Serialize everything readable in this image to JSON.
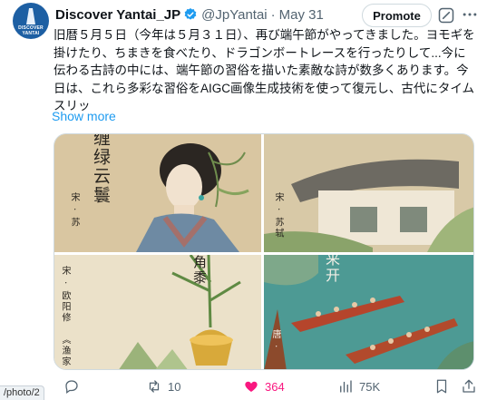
{
  "author": {
    "name": "Discover Yantai_JP",
    "handle": "@JpYantai",
    "separator": "·",
    "date": "May 31",
    "avatar_text": "DISCOVER YANTAI"
  },
  "header_actions": {
    "promote_label": "Promote",
    "grok_icon": "grok-icon",
    "more_icon": "more-icon"
  },
  "tweet": {
    "text": "旧暦５月５日（今年は５月３１日）、再び端午節がやってきました。ヨモギを掛けたり、ちまきを食べたり、ドラゴンボートレースを行ったりして...今に伝わる古詩の中には、端午節の習俗を描いた素敵な詩が数多くあります。今日は、これら多彩な習俗をAIGC画像生成技術を使って復元し、古代にタイムスリッ",
    "show_more": "Show more"
  },
  "media": {
    "panel1": {
      "title": "缠绿云鬟",
      "credit": "宋 · 苏"
    },
    "panel2": {
      "credit": "宋 · 苏轼"
    },
    "panel3": {
      "title": "角黍",
      "credit": "宋 · 欧阳修",
      "poem": "《渔家"
    },
    "panel4": {
      "title": "来开",
      "credit": "唐 ·"
    }
  },
  "actions": {
    "reply_icon": "reply-icon",
    "repost_count": "10",
    "like_count": "364",
    "views_count": "75K",
    "like_color": "#f91880"
  },
  "status_bar": {
    "url": "/photo/2"
  },
  "colors": {
    "accent": "#1d9bf0",
    "secondary_text": "#536471",
    "verified": "#1d9bf0"
  }
}
